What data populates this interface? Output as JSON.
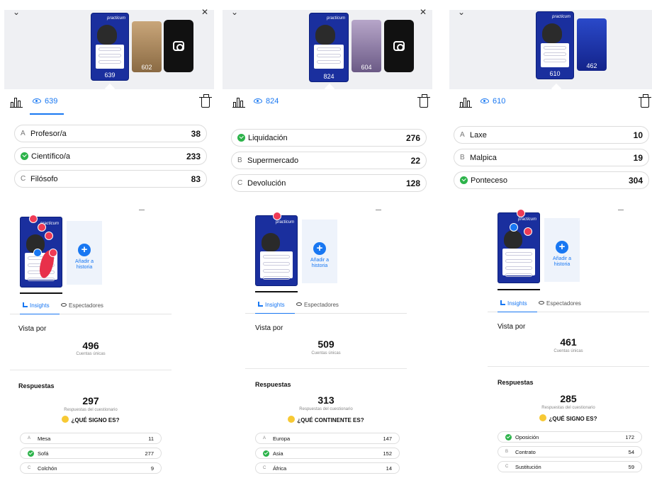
{
  "colors": {
    "accent": "#1877f2",
    "correct": "#2cb34a",
    "heart": "#ef3b55",
    "story_bg": "#1a2f9e"
  },
  "icons": [
    "chevron-down-icon",
    "close-icon",
    "camera-icon",
    "bar-chart-icon",
    "eye-icon",
    "trash-icon",
    "check-icon",
    "plus-icon",
    "insights-icon",
    "emoji-icon"
  ],
  "panels": [
    {
      "thumb_views_main": "639",
      "thumb_views_second": "602",
      "views": "639",
      "options": [
        {
          "letter": "A",
          "label": "Profesor/a",
          "count": "38",
          "correct": false
        },
        {
          "letter": "",
          "label": "Científico/a",
          "count": "233",
          "correct": true
        },
        {
          "letter": "C",
          "label": "Filósofo",
          "count": "83",
          "correct": false
        }
      ],
      "add_story": "Añadir a historia",
      "tab_insights": "Insights",
      "tab_spectators": "Espectadores",
      "vista_por": "Vista por",
      "accounts_count": "496",
      "accounts_label": "Cuentas únicas",
      "responses_title": "Respuestas",
      "responses_count": "297",
      "responses_label": "Respuestas del cuestionario",
      "question": "¿QUÉ SIGNO ES?",
      "mini_options": [
        {
          "letter": "A",
          "label": "Mesa",
          "count": "11",
          "correct": false
        },
        {
          "letter": "",
          "label": "Sofá",
          "count": "277",
          "correct": true
        },
        {
          "letter": "C",
          "label": "Colchón",
          "count": "9",
          "correct": false
        }
      ]
    },
    {
      "thumb_views_main": "824",
      "thumb_views_second": "604",
      "views": "824",
      "options": [
        {
          "letter": "",
          "label": "Liquidación",
          "count": "276",
          "correct": true
        },
        {
          "letter": "B",
          "label": "Supermercado",
          "count": "22",
          "correct": false
        },
        {
          "letter": "C",
          "label": "Devolución",
          "count": "128",
          "correct": false
        }
      ],
      "add_story": "Añadir a historia",
      "tab_insights": "Insights",
      "tab_spectators": "Espectadores",
      "vista_por": "Vista por",
      "accounts_count": "509",
      "accounts_label": "Cuentas únicas",
      "responses_title": "Respuestas",
      "responses_count": "313",
      "responses_label": "Respuestas del cuestionario",
      "question": "¿QUÉ CONTINENTE ES?",
      "mini_options": [
        {
          "letter": "A",
          "label": "Europa",
          "count": "147",
          "correct": false
        },
        {
          "letter": "",
          "label": "Asia",
          "count": "152",
          "correct": true
        },
        {
          "letter": "C",
          "label": "África",
          "count": "14",
          "correct": false
        }
      ]
    },
    {
      "thumb_views_main": "610",
      "thumb_views_second": "462",
      "views": "610",
      "options": [
        {
          "letter": "A",
          "label": "Laxe",
          "count": "10",
          "correct": false
        },
        {
          "letter": "B",
          "label": "Malpica",
          "count": "19",
          "correct": false
        },
        {
          "letter": "",
          "label": "Ponteceso",
          "count": "304",
          "correct": true
        }
      ],
      "add_story": "Añadir a historia",
      "tab_insights": "Insights",
      "tab_spectators": "Espectadores",
      "vista_por": "Vista por",
      "accounts_count": "461",
      "accounts_label": "Cuentas únicas",
      "responses_title": "Respuestas",
      "responses_count": "285",
      "responses_label": "Respuestas del cuestionario",
      "question": "¿QUÉ SIGNO ES?",
      "mini_options": [
        {
          "letter": "",
          "label": "Oposición",
          "count": "172",
          "correct": true
        },
        {
          "letter": "B",
          "label": "Contrato",
          "count": "54",
          "correct": false
        },
        {
          "letter": "C",
          "label": "Sustitución",
          "count": "59",
          "correct": false
        }
      ]
    }
  ]
}
